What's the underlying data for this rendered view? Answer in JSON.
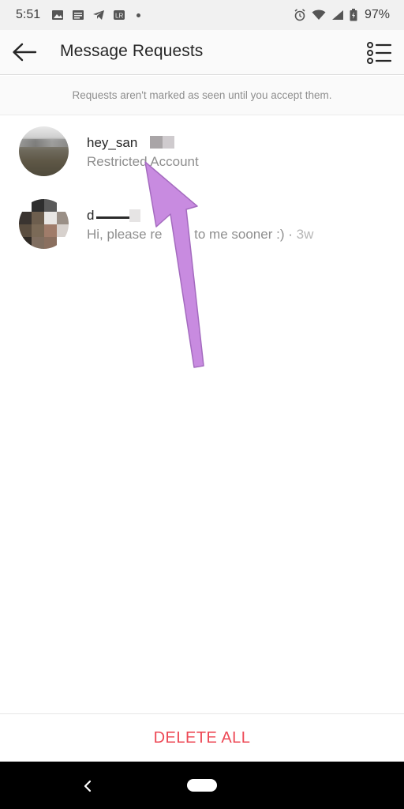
{
  "status_bar": {
    "time": "5:51",
    "battery_percent": "97%",
    "left_icons": [
      "image-icon",
      "news-icon",
      "telegram-icon",
      "lightroom-icon",
      "dot-icon"
    ],
    "right_icons": [
      "alarm-icon",
      "wifi-icon",
      "signal-icon",
      "battery-icon"
    ]
  },
  "header": {
    "title": "Message Requests",
    "back_icon": "back-arrow-icon",
    "menu_icon": "list-icon"
  },
  "notice": {
    "text": "Requests aren't marked as seen until you accept them."
  },
  "threads": [
    {
      "name": "hey_san",
      "subtitle": "Restricted Account"
    },
    {
      "name": "d",
      "preview": "Hi, please re",
      "preview_tail": " to me sooner :) · ",
      "time": "3w"
    }
  ],
  "footer": {
    "delete_all_label": "DELETE ALL"
  },
  "colors": {
    "accent_red": "#ed4956",
    "annotation_arrow": "#c88be0",
    "secondary_text": "#8e8e8e"
  }
}
